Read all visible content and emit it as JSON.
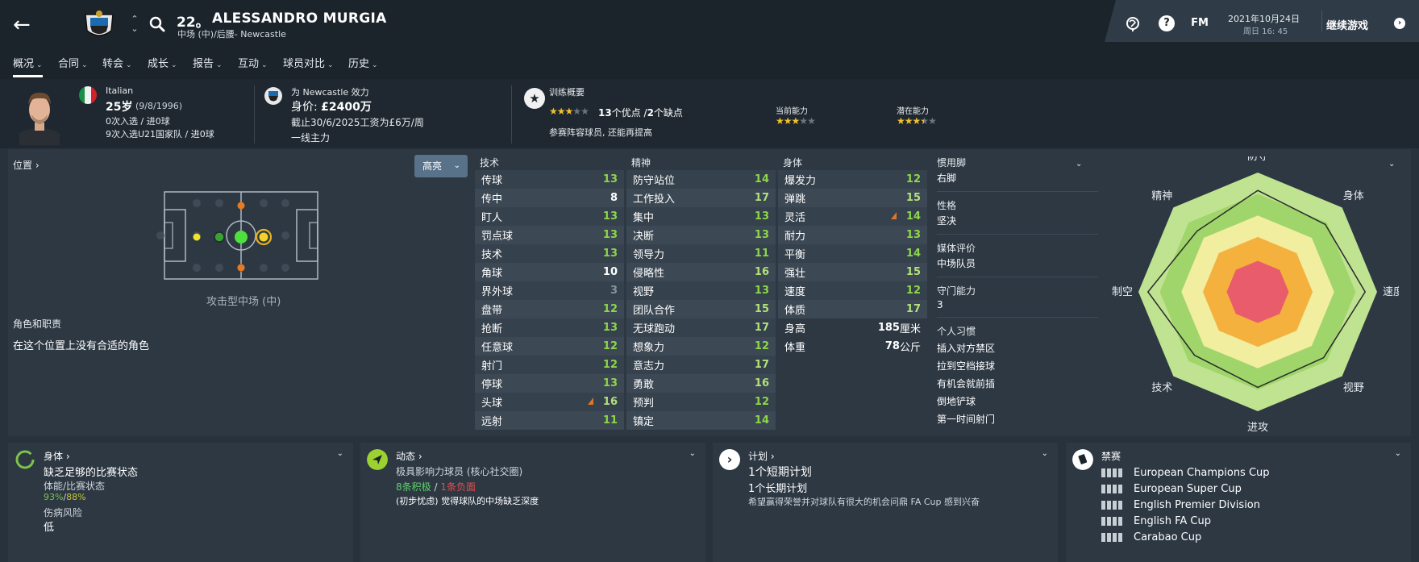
{
  "header": {
    "number": "22。",
    "name": "ALESSANDRO MURGIA",
    "subtitle": "中场 (中)/后腰- Newcastle",
    "fm_label": "FM",
    "date": "2021年10月24日",
    "time": "周日 16: 45",
    "continue_label": "继续游戏"
  },
  "tabs": [
    {
      "label": "概况",
      "active": true
    },
    {
      "label": "合同"
    },
    {
      "label": "转会"
    },
    {
      "label": "成长"
    },
    {
      "label": "报告"
    },
    {
      "label": "互动"
    },
    {
      "label": "球员对比"
    },
    {
      "label": "历史"
    }
  ],
  "profile": {
    "nationality": "Italian",
    "age": "25岁",
    "dob": "(9/8/1996)",
    "caps": "0次入选 / 进0球",
    "u21_caps": "9次入选U21国家队 / 进0球",
    "plays_for": "为 Newcastle 效力",
    "value_label": "身价:",
    "value": "£2400万",
    "contract": "截止30/6/2025工资为£6万/周",
    "squad_status": "一线主力",
    "training_title": "训练概要",
    "training_stars": 3,
    "strengths_count": "13",
    "strengths_label": "个优点 /",
    "weaknesses_count": "2",
    "weaknesses_label": "个缺点",
    "training_note": "参赛阵容球员, 还能再提高",
    "current_ability_label": "当前能力",
    "current_ability_stars": 3,
    "potential_ability_label": "潜在能力",
    "potential_ability_stars": 3.5
  },
  "position": {
    "title": "位置",
    "highlight_label": "高亮",
    "caption": "攻击型中场 (中)",
    "role_title": "角色和职责",
    "role_note": "在这个位置上没有合适的角色"
  },
  "attributes": {
    "technical": {
      "header": "技术",
      "rows": [
        {
          "name": "传球",
          "value": "13",
          "cls": "v-green"
        },
        {
          "name": "传中",
          "value": "8",
          "cls": "v-white"
        },
        {
          "name": "盯人",
          "value": "13",
          "cls": "v-green"
        },
        {
          "name": "罚点球",
          "value": "13",
          "cls": "v-green"
        },
        {
          "name": "技术",
          "value": "13",
          "cls": "v-green"
        },
        {
          "name": "角球",
          "value": "10",
          "cls": "v-white"
        },
        {
          "name": "界外球",
          "value": "3",
          "cls": "v-grey"
        },
        {
          "name": "盘带",
          "value": "12",
          "cls": "v-green"
        },
        {
          "name": "抢断",
          "value": "13",
          "cls": "v-green"
        },
        {
          "name": "任意球",
          "value": "12",
          "cls": "v-green"
        },
        {
          "name": "射门",
          "value": "12",
          "cls": "v-green"
        },
        {
          "name": "停球",
          "value": "13",
          "cls": "v-green"
        },
        {
          "name": "头球",
          "value": "16",
          "cls": "v-lgreen",
          "up": true
        },
        {
          "name": "远射",
          "value": "11",
          "cls": "v-green"
        }
      ]
    },
    "mental": {
      "header": "精神",
      "rows": [
        {
          "name": "防守站位",
          "value": "14",
          "cls": "v-green"
        },
        {
          "name": "工作投入",
          "value": "17",
          "cls": "v-lgreen"
        },
        {
          "name": "集中",
          "value": "13",
          "cls": "v-green"
        },
        {
          "name": "决断",
          "value": "13",
          "cls": "v-green"
        },
        {
          "name": "领导力",
          "value": "11",
          "cls": "v-green"
        },
        {
          "name": "侵略性",
          "value": "16",
          "cls": "v-lgreen"
        },
        {
          "name": "视野",
          "value": "13",
          "cls": "v-green"
        },
        {
          "name": "团队合作",
          "value": "15",
          "cls": "v-lgreen"
        },
        {
          "name": "无球跑动",
          "value": "17",
          "cls": "v-lgreen"
        },
        {
          "name": "想象力",
          "value": "12",
          "cls": "v-green"
        },
        {
          "name": "意志力",
          "value": "17",
          "cls": "v-lgreen"
        },
        {
          "name": "勇敢",
          "value": "16",
          "cls": "v-lgreen"
        },
        {
          "name": "预判",
          "value": "12",
          "cls": "v-green"
        },
        {
          "name": "镇定",
          "value": "14",
          "cls": "v-green"
        }
      ]
    },
    "physical": {
      "header": "身体",
      "rows": [
        {
          "name": "爆发力",
          "value": "12",
          "cls": "v-green"
        },
        {
          "name": "弹跳",
          "value": "15",
          "cls": "v-lgreen"
        },
        {
          "name": "灵活",
          "value": "14",
          "cls": "v-green",
          "up": true
        },
        {
          "name": "耐力",
          "value": "13",
          "cls": "v-green"
        },
        {
          "name": "平衡",
          "value": "14",
          "cls": "v-green"
        },
        {
          "name": "强壮",
          "value": "15",
          "cls": "v-lgreen"
        },
        {
          "name": "速度",
          "value": "12",
          "cls": "v-green"
        },
        {
          "name": "体质",
          "value": "17",
          "cls": "v-lgreen"
        }
      ],
      "height_label": "身高",
      "height_value": "185",
      "height_unit": "厘米",
      "weight_label": "体重",
      "weight_value": "78",
      "weight_unit": "公斤"
    }
  },
  "traits": {
    "foot_label": "惯用脚",
    "foot_value": "右脚",
    "personality_label": "性格",
    "personality_value": "坚决",
    "media_label": "媒体评价",
    "media_value": "中场队员",
    "defense_label": "守门能力",
    "defense_value": "3",
    "habits_label": "个人习惯",
    "habits": [
      "插入对方禁区",
      "拉到空档接球",
      "有机会就前插",
      "倒地铲球",
      "第一时间射门"
    ]
  },
  "radar": {
    "labels": [
      "防守",
      "身体",
      "速度",
      "视野",
      "进攻",
      "技术",
      "制空",
      "精神"
    ],
    "values": [
      0.85,
      0.8,
      0.9,
      0.78,
      0.8,
      0.75,
      0.92,
      0.72
    ]
  },
  "cards": {
    "physical": {
      "title": "身体",
      "status": "缺乏足够的比赛状态",
      "cond_label": "体能/比赛状态",
      "cond_value": "93%",
      "sharp_value": "88%",
      "injury_label": "伤病风险",
      "injury_value": "低"
    },
    "dynamics": {
      "title": "动态",
      "influence": "极具影响力球员 (核心社交圈)",
      "positive": "8条积极",
      "negative": "1条负面",
      "note": "(初步忧虑) 觉得球队的中场缺乏深度"
    },
    "plans": {
      "title": "计划",
      "short": "1个短期计划",
      "long": "1个长期计划",
      "note": "希望赢得荣誉并对球队有很大的机会问鼎 FA Cup 感到兴奋"
    },
    "bans": {
      "title": "禁赛",
      "items": [
        "European Champions Cup",
        "European Super Cup",
        "English Premier Division",
        "English FA Cup",
        "Carabao Cup"
      ]
    }
  }
}
